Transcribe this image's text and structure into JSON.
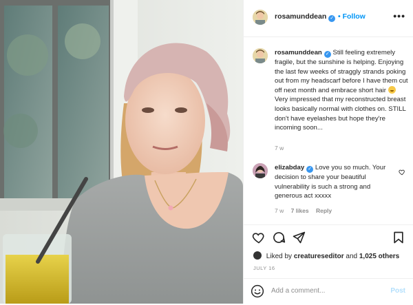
{
  "post": {
    "author": "rosamunddean",
    "follow_label": "Follow",
    "follow_dot": "•",
    "more_label": "•••",
    "caption": {
      "author": "rosamunddean",
      "text": "Still feeling extremely fragile, but the sunshine is helping. Enjoying the last few weeks of straggly strands poking out from my headscarf before I have them cut off next month and embrace short hair",
      "text_after_emoji": "Very impressed that my reconstructed breast looks basically normal with clothes on. STILL don't have eyelashes but hope they're incoming soon...",
      "ago": "7 w"
    },
    "comment": {
      "author": "elizabday",
      "text": "Love you so much. Your decision to share your beautiful vulnerability is such a strong and generous act xxxxx",
      "ago": "7 w",
      "likes": "7 likes",
      "reply": "Reply"
    },
    "likes": {
      "prefix": "Liked by",
      "user": "creatureseditor",
      "joiner": "and",
      "count": "1,025 others"
    },
    "date": "JULY 16",
    "add_comment": {
      "placeholder": "Add a comment...",
      "post_label": "Post"
    }
  },
  "icons": {
    "verified": "verified-badge-icon",
    "more": "more-options-icon",
    "like": "heart-icon",
    "comment": "comment-icon",
    "share": "send-icon",
    "save": "bookmark-icon",
    "emoji": "smiley-icon"
  },
  "colors": {
    "accent": "#0095f6",
    "verified": "#3897f0",
    "muted": "#8e8e8e",
    "post_disabled": "#b2dffc"
  }
}
